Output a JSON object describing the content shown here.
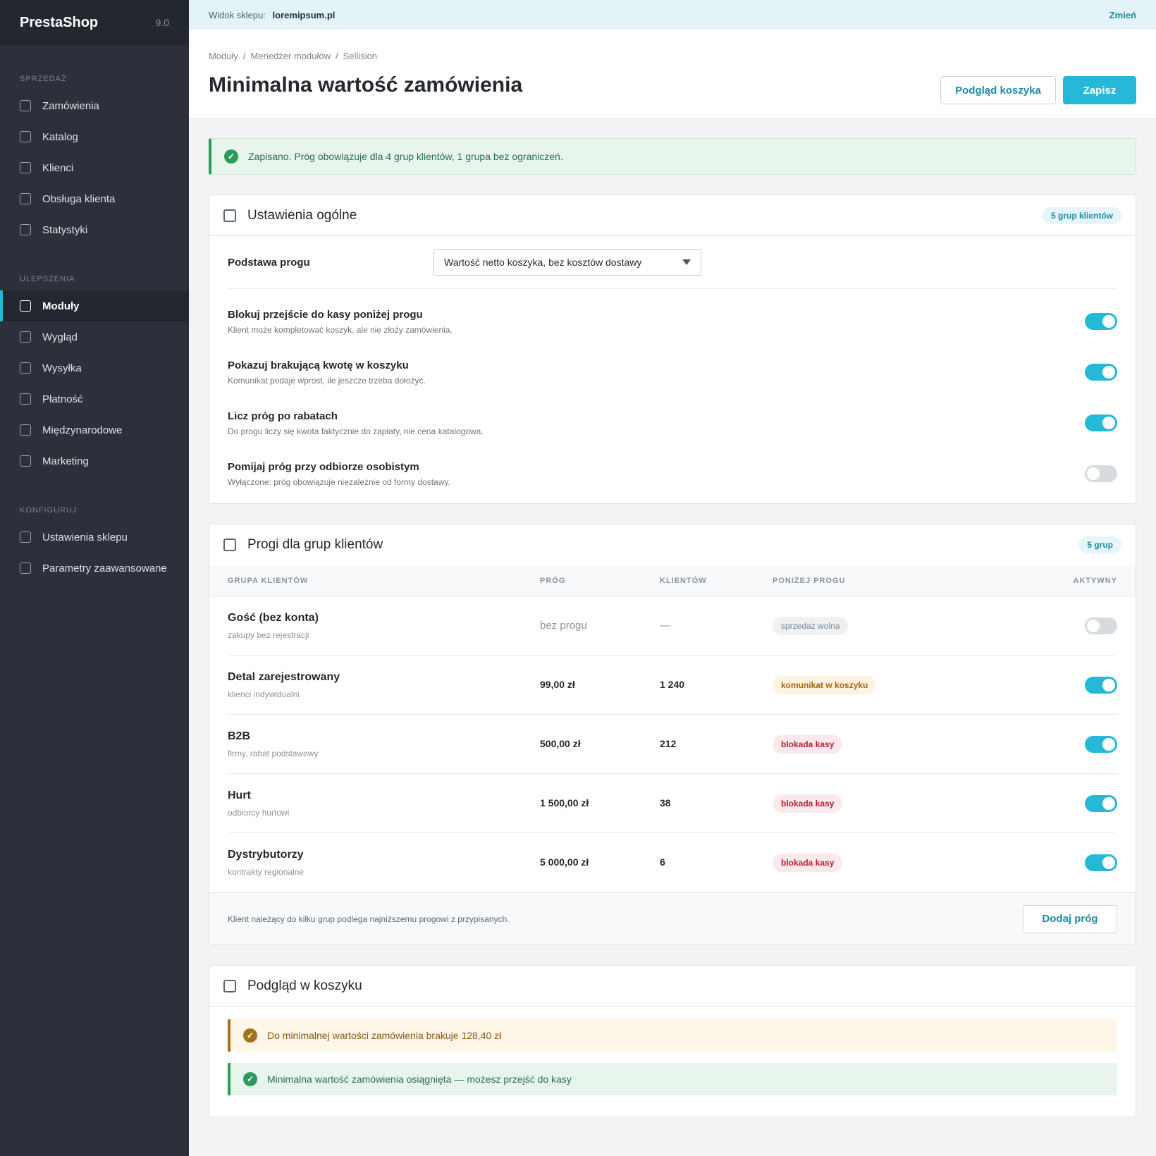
{
  "brand": {
    "name": "PrestaShop",
    "version": "9.0"
  },
  "sidebar": {
    "sections": [
      {
        "label": "SPRZEDAŻ",
        "items": [
          "Zamówienia",
          "Katalog",
          "Klienci",
          "Obsługa klienta",
          "Statystyki"
        ]
      },
      {
        "label": "ULEPSZENIA",
        "items": [
          "Moduły",
          "Wygląd",
          "Wysyłka",
          "Płatność",
          "Międzynarodowe",
          "Marketing"
        ]
      },
      {
        "label": "KONFIGURUJ",
        "items": [
          "Ustawienia sklepu",
          "Parametry zaawansowane"
        ]
      }
    ],
    "active": "Moduły"
  },
  "topbar": {
    "label": "Widok sklepu:",
    "shop": "loremipsum.pl",
    "change": "Zmień"
  },
  "header": {
    "breadcrumb": [
      "Moduły",
      "Menedżer modułów",
      "Sellision"
    ],
    "title": "Minimalna wartość zamówienia",
    "preview_button": "Podgląd koszyka",
    "save_button": "Zapisz"
  },
  "alert": {
    "text": "Zapisano. Próg obowiązuje dla 4 grup klientów, 1 grupa bez ograniczeń."
  },
  "general": {
    "title": "Ustawienia ogólne",
    "badge": "5 grup klientów",
    "basis_label": "Podstawa progu",
    "basis_value": "Wartość netto koszyka, bez kosztów dostawy",
    "toggles": [
      {
        "title": "Blokuj przejście do kasy poniżej progu",
        "desc": "Klient może kompletować koszyk, ale nie złoży zamówienia.",
        "on": true
      },
      {
        "title": "Pokazuj brakującą kwotę w koszyku",
        "desc": "Komunikat podaje wprost, ile jeszcze trzeba dołożyć.",
        "on": true
      },
      {
        "title": "Licz próg po rabatach",
        "desc": "Do progu liczy się kwota faktycznie do zapłaty, nie cena katalogowa.",
        "on": true
      },
      {
        "title": "Pomijaj próg przy odbiorze osobistym",
        "desc": "Wyłączone: próg obowiązuje niezależnie od formy dostawy.",
        "on": false
      }
    ]
  },
  "groups": {
    "title": "Progi dla grup klientów",
    "badge": "5 grup",
    "columns": [
      "GRUPA KLIENTÓW",
      "PRÓG",
      "KLIENTÓW",
      "PONIŻEJ PROGU",
      "AKTYWNY"
    ],
    "rows": [
      {
        "name": "Gość (bez konta)",
        "sub": "zakupy bez rejestracji",
        "threshold": "bez progu",
        "count": "—",
        "status": "sprzedaż wolna",
        "status_type": "gray",
        "active": false
      },
      {
        "name": "Detal zarejestrowany",
        "sub": "klienci indywidualni",
        "threshold": "99,00 zł",
        "count": "1 240",
        "status": "komunikat w koszyku",
        "status_type": "amber",
        "active": true
      },
      {
        "name": "B2B",
        "sub": "firmy, rabat podstawowy",
        "threshold": "500,00 zł",
        "count": "212",
        "status": "blokada kasy",
        "status_type": "red",
        "active": true
      },
      {
        "name": "Hurt",
        "sub": "odbiorcy hurtowi",
        "threshold": "1 500,00 zł",
        "count": "38",
        "status": "blokada kasy",
        "status_type": "red",
        "active": true
      },
      {
        "name": "Dystrybutorzy",
        "sub": "kontrakty regionalne",
        "threshold": "5 000,00 zł",
        "count": "6",
        "status": "blokada kasy",
        "status_type": "red",
        "active": true
      }
    ],
    "footer_note": "Klient należący do kilku grup podlega najniższemu progowi z przypisanych.",
    "add_button": "Dodaj próg"
  },
  "preview": {
    "title": "Podgląd w koszyku",
    "warn_text": "Do minimalnej wartości zamówienia brakuje 128,40 zł",
    "ok_text": "Minimalna wartość zamówienia osiągnięta — możesz przejść do kasy"
  },
  "colors": {
    "accent": "#25b9d7",
    "sidebar": "#2b303b",
    "success": "#2c9a5b",
    "warning": "#a5711a",
    "danger": "#b42338"
  }
}
